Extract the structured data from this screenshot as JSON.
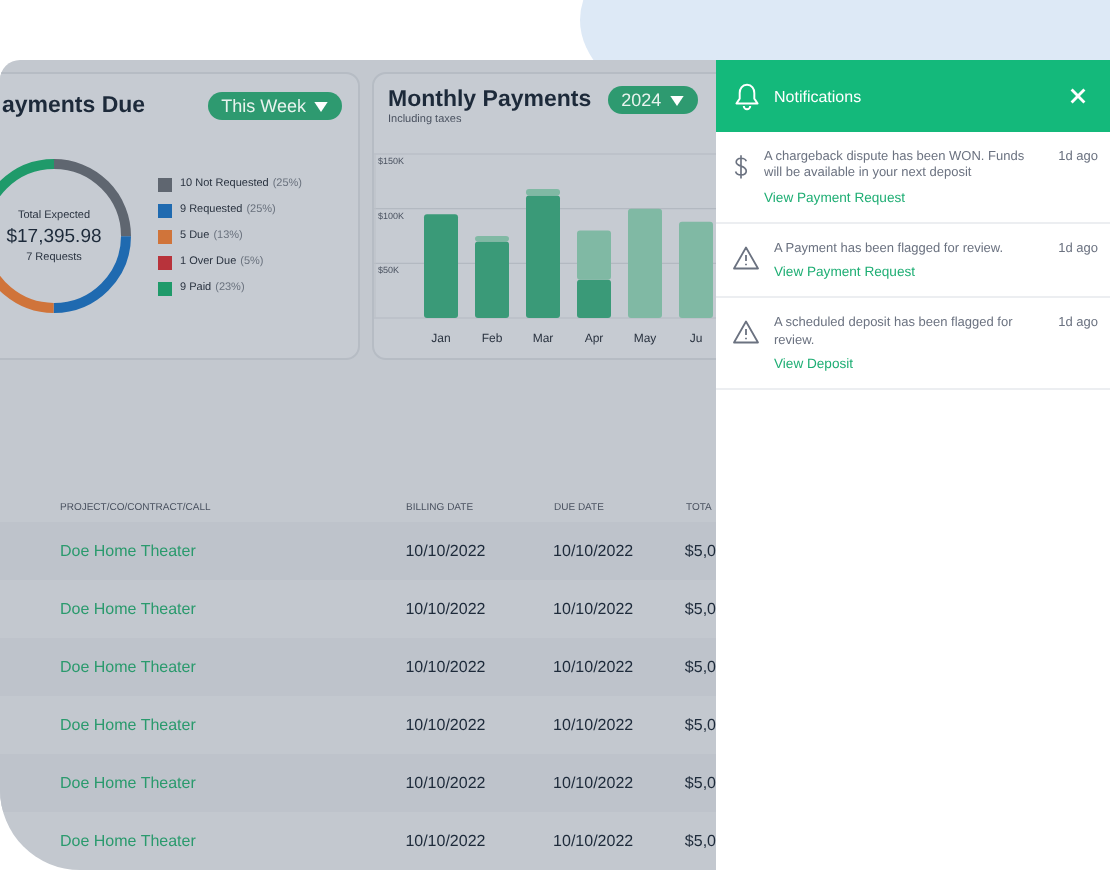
{
  "payments_due": {
    "title": "ayments Due",
    "period": "This Week",
    "total_label": "Total Expected",
    "total": "$17,395.98",
    "requests": "7 Requests",
    "legend": [
      {
        "label": "10 Not Requested",
        "share": "(25%)",
        "color": "#5f6670"
      },
      {
        "label": "9 Requested",
        "share": "(25%)",
        "color": "#1f6ab0"
      },
      {
        "label": "5 Due",
        "share": "(13%)",
        "color": "#d0743a"
      },
      {
        "label": "1 Over Due",
        "share": "(5%)",
        "color": "#b8333b"
      },
      {
        "label": "9 Paid",
        "share": "(23%)",
        "color": "#1f9a6a"
      }
    ]
  },
  "monthly_payments": {
    "title": "Monthly Payments",
    "year": "2024",
    "subtitle": "Including taxes",
    "chart_data": {
      "type": "bar",
      "stacked": true,
      "categories": [
        "Jan",
        "Feb",
        "Mar",
        "Apr",
        "May",
        "Ju"
      ],
      "ylim": [
        0,
        150
      ],
      "yticks": [
        {
          "value": 50,
          "label": "$50K"
        },
        {
          "value": 100,
          "label": "$100K"
        },
        {
          "value": 150,
          "label": "$150K"
        }
      ],
      "series": [
        {
          "color": "#3a9a78",
          "values": [
            95,
            70,
            112,
            35,
            0,
            0
          ]
        },
        {
          "color": "#80b9a4",
          "values": [
            0,
            5,
            6,
            45,
            100,
            88
          ]
        }
      ]
    }
  },
  "table": {
    "columns": [
      "PROJECT/CO/CONTRACT/CALL",
      "BILLING DATE",
      "DUE DATE",
      "TOTA"
    ],
    "rows": [
      {
        "project": "Doe Home Theater",
        "billing_date": "10/10/2022",
        "due_date": "10/10/2022",
        "total": "$5,0"
      },
      {
        "project": "Doe Home Theater",
        "billing_date": "10/10/2022",
        "due_date": "10/10/2022",
        "total": "$5,0"
      },
      {
        "project": "Doe Home Theater",
        "billing_date": "10/10/2022",
        "due_date": "10/10/2022",
        "total": "$5,0"
      },
      {
        "project": "Doe Home Theater",
        "billing_date": "10/10/2022",
        "due_date": "10/10/2022",
        "total": "$5,0"
      },
      {
        "project": "Doe Home Theater",
        "billing_date": "10/10/2022",
        "due_date": "10/10/2022",
        "total": "$5,0"
      },
      {
        "project": "Doe Home Theater",
        "billing_date": "10/10/2022",
        "due_date": "10/10/2022",
        "total": "$5,0"
      }
    ]
  },
  "notifications": {
    "title": "Notifications",
    "items": [
      {
        "kind": "dollar",
        "message": "A chargeback dispute has been WON. Funds will be available in your next deposit",
        "link": "View Payment Request",
        "time": "1d ago"
      },
      {
        "kind": "warning",
        "message": "A Payment has been flagged for review.",
        "link": "View Payment Request",
        "time": "1d ago"
      },
      {
        "kind": "warning",
        "message": "A scheduled deposit has been flagged for review.",
        "link": "View Deposit",
        "time": "1d ago"
      }
    ]
  }
}
